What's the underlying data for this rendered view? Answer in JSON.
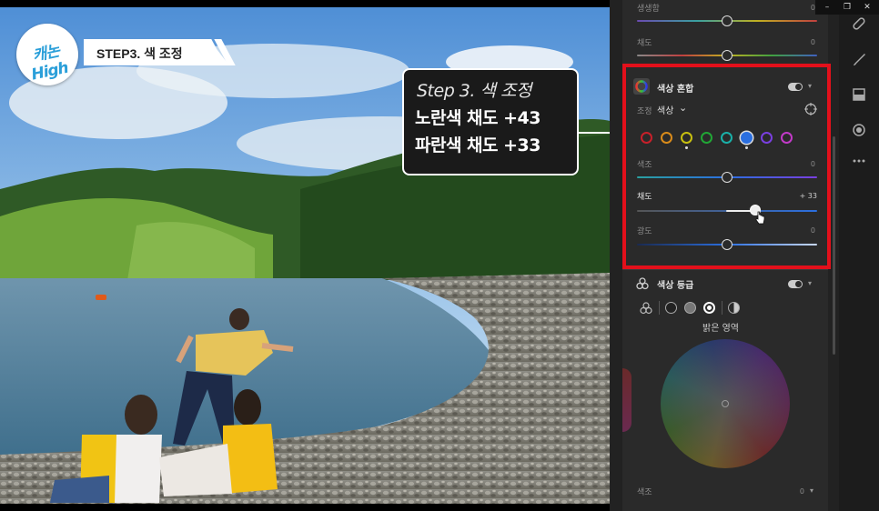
{
  "overlay": {
    "logo_text": "캐논High",
    "step_banner": "STEP3. 색 조정",
    "callout": {
      "title": "Step 3. 색 조정",
      "line1": "노란색 채도 +43",
      "line2": "파란색 채도 +33"
    }
  },
  "panel": {
    "top_sliders": [
      {
        "label": "생생함",
        "value": "0",
        "position": 0.5
      },
      {
        "label": "채도",
        "value": "0",
        "position": 0.5
      }
    ],
    "color_mix": {
      "title": "색상 혼합",
      "toggle_on": true,
      "adjust_label": "조정",
      "adjust_value": "색상",
      "swatches": [
        {
          "name": "red",
          "color": "#c8202a"
        },
        {
          "name": "orange",
          "color": "#d98b1a"
        },
        {
          "name": "yellow",
          "color": "#c8c010"
        },
        {
          "name": "green",
          "color": "#21a636"
        },
        {
          "name": "aqua",
          "color": "#1ab0a8"
        },
        {
          "name": "blue",
          "color": "#2b6fe0",
          "selected": true
        },
        {
          "name": "purple",
          "color": "#7a3fe0"
        },
        {
          "name": "magenta",
          "color": "#c23ac8"
        }
      ],
      "sliders": [
        {
          "label": "색조",
          "value": "0",
          "position": 0.5
        },
        {
          "label": "채도",
          "value": "+ 33",
          "position": 0.665,
          "active": true
        },
        {
          "label": "광도",
          "value": "0",
          "position": 0.5
        }
      ]
    },
    "color_grading": {
      "title": "색상 등급",
      "toggle_on": true,
      "region_label": "밝은 영역",
      "bottom_label": "색조",
      "bottom_value": "0"
    }
  },
  "tools": [
    "heal-icon",
    "brush-icon",
    "mask-icon",
    "radial-icon",
    "more-icon"
  ],
  "window": {
    "minimize": "–",
    "restore": "❐",
    "close": "✕"
  },
  "colors": {
    "highlight": "#e3101b",
    "panel_bg": "#2a2a2a",
    "accent_blue": "#2b6fe0"
  }
}
